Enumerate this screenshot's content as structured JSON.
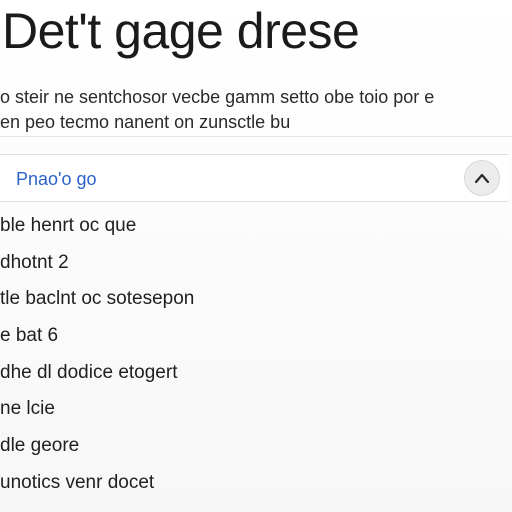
{
  "page": {
    "title": "Det't gage drese"
  },
  "description": {
    "line1": "o steir ne sentchosor vecbe gamm setto  obe toio  por e",
    "line2": "en peo tecmo nanent on zunsctle bu"
  },
  "selector": {
    "value": "Pnao'o go",
    "toggle_icon": "chevron-up-icon"
  },
  "list": {
    "items": [
      {
        "label": "ble henrt oc que"
      },
      {
        "label": "dhotnt  2"
      },
      {
        "label": "tle baclnt oc sotesepon"
      },
      {
        "label": "e bat  6"
      },
      {
        "label": "dhe dl dodice etogert"
      },
      {
        "label": "ne lcie"
      },
      {
        "label": "dle geore"
      },
      {
        "label": "unotics  venr  docet"
      }
    ]
  }
}
